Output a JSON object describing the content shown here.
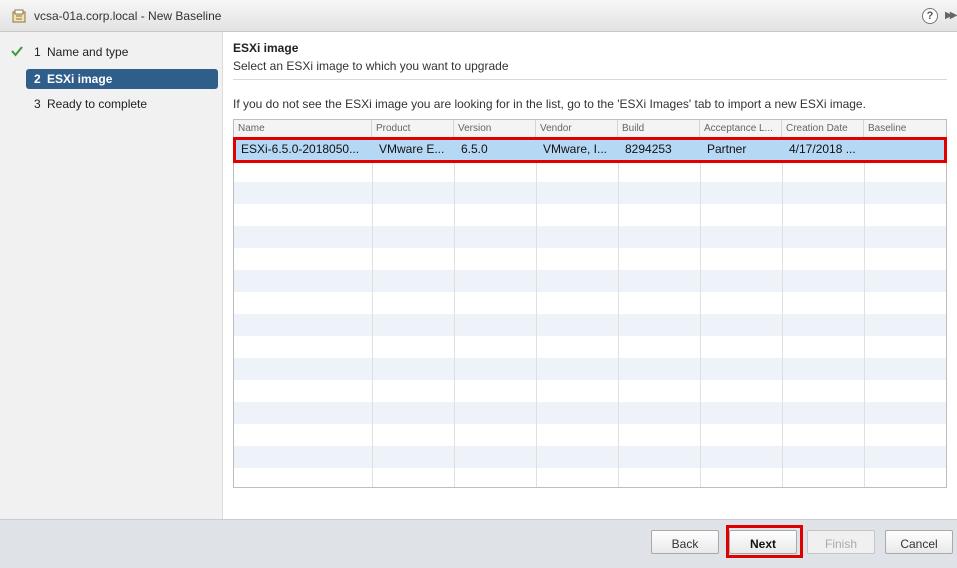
{
  "window": {
    "title": "vcsa-01a.corp.local - New Baseline",
    "help_glyph": "?",
    "expand_glyph": "▶▶"
  },
  "nav": {
    "items": [
      {
        "num": "1",
        "label": "Name and type",
        "state": "done"
      },
      {
        "num": "2",
        "label": "ESXi image",
        "state": "active"
      },
      {
        "num": "3",
        "label": "Ready to complete",
        "state": "pending"
      }
    ]
  },
  "main": {
    "section_title": "ESXi image",
    "section_subtitle": "Select an ESXi image to which you want to upgrade",
    "hint": "If you do not see the ESXi image you are looking for in the list, go to the 'ESXi Images' tab to import a new ESXi image."
  },
  "table": {
    "columns": [
      "Name",
      "Product",
      "Version",
      "Vendor",
      "Build",
      "Acceptance L...",
      "Creation Date",
      "Baseline"
    ],
    "rows": [
      [
        "ESXi-6.5.0-2018050...",
        "VMware E...",
        "6.5.0",
        "VMware, I...",
        "8294253",
        "Partner",
        "4/17/2018 ...",
        ""
      ]
    ],
    "selected_row": 0
  },
  "footer": {
    "back_label": "Back",
    "next_label": "Next",
    "finish_label": "Finish",
    "cancel_label": "Cancel"
  },
  "colors": {
    "accent": "#2f5e8a",
    "selected_row": "#b5d8f5",
    "annotation": "#e00000",
    "check": "#3a9a3a"
  }
}
